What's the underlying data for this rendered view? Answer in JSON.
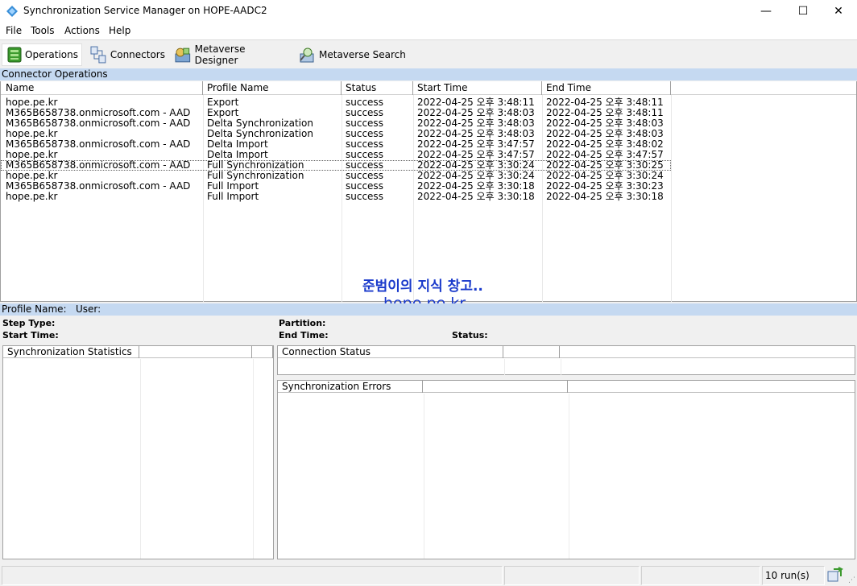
{
  "window": {
    "title": "Synchronization Service Manager on HOPE-AADC2",
    "minimize": "—",
    "maximize": "☐",
    "close": "✕"
  },
  "menu": [
    "File",
    "Tools",
    "Actions",
    "Help"
  ],
  "toolbar": {
    "operations": "Operations",
    "connectors": "Connectors",
    "metaverse_designer": "Metaverse Designer",
    "metaverse_search": "Metaverse Search"
  },
  "connector_operations": {
    "title": "Connector Operations",
    "columns": [
      "Name",
      "Profile Name",
      "Status",
      "Start Time",
      "End Time"
    ],
    "rows": [
      [
        "hope.pe.kr",
        "Export",
        "success",
        "2022-04-25 오후 3:48:11",
        "2022-04-25 오후 3:48:11"
      ],
      [
        "M365B658738.onmicrosoft.com - AAD",
        "Export",
        "success",
        "2022-04-25 오후 3:48:03",
        "2022-04-25 오후 3:48:11"
      ],
      [
        "M365B658738.onmicrosoft.com - AAD",
        "Delta Synchronization",
        "success",
        "2022-04-25 오후 3:48:03",
        "2022-04-25 오후 3:48:03"
      ],
      [
        "hope.pe.kr",
        "Delta Synchronization",
        "success",
        "2022-04-25 오후 3:48:03",
        "2022-04-25 오후 3:48:03"
      ],
      [
        "M365B658738.onmicrosoft.com - AAD",
        "Delta Import",
        "success",
        "2022-04-25 오후 3:47:57",
        "2022-04-25 오후 3:48:02"
      ],
      [
        "hope.pe.kr",
        "Delta Import",
        "success",
        "2022-04-25 오후 3:47:57",
        "2022-04-25 오후 3:47:57"
      ],
      [
        "M365B658738.onmicrosoft.com - AAD",
        "Full Synchronization",
        "success",
        "2022-04-25 오후 3:30:24",
        "2022-04-25 오후 3:30:25"
      ],
      [
        "hope.pe.kr",
        "Full Synchronization",
        "success",
        "2022-04-25 오후 3:30:24",
        "2022-04-25 오후 3:30:24"
      ],
      [
        "M365B658738.onmicrosoft.com - AAD",
        "Full Import",
        "success",
        "2022-04-25 오후 3:30:18",
        "2022-04-25 오후 3:30:23"
      ],
      [
        "hope.pe.kr",
        "Full Import",
        "success",
        "2022-04-25 오후 3:30:18",
        "2022-04-25 오후 3:30:18"
      ]
    ]
  },
  "watermark": {
    "line1": "준범이의 지식 창고..",
    "line2": "hope.pe.kr"
  },
  "details": {
    "profile_name": "Profile Name:",
    "user": "User:",
    "step_type": "Step Type:",
    "start_time": "Start Time:",
    "partition": "Partition:",
    "end_time": "End Time:",
    "status": "Status:"
  },
  "panels": {
    "sync_stats": "Synchronization Statistics",
    "connection_status": "Connection Status",
    "sync_errors": "Synchronization Errors"
  },
  "statusbar": {
    "runs": "10 run(s)"
  },
  "colors": {
    "section_bar": "#c5d9f1",
    "watermark": "#1a3acb"
  }
}
